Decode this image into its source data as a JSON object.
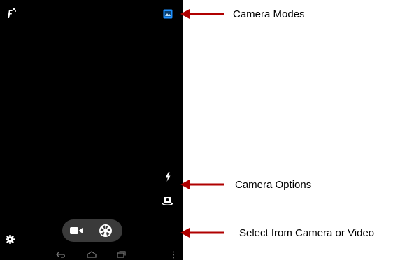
{
  "screen": {
    "icons": {
      "hdr": "hdr-icon",
      "camera_mode": "picture-mode-icon",
      "flash": "flash-icon",
      "switch_camera": "switch-camera-icon",
      "settings": "gear-icon",
      "video": "video-camera-icon",
      "shutter": "shutter-icon",
      "back": "back-icon",
      "home": "home-icon",
      "recents": "recent-apps-icon",
      "menu": "overflow-menu-icon"
    }
  },
  "annotations": {
    "camera_modes": "Camera Modes",
    "camera_options": "Camera Options",
    "select_mode": "Select from Camera or Video"
  },
  "colors": {
    "arrow": "#b00000",
    "mode_icon": "#1e90ff",
    "screen_bg": "#000000"
  }
}
